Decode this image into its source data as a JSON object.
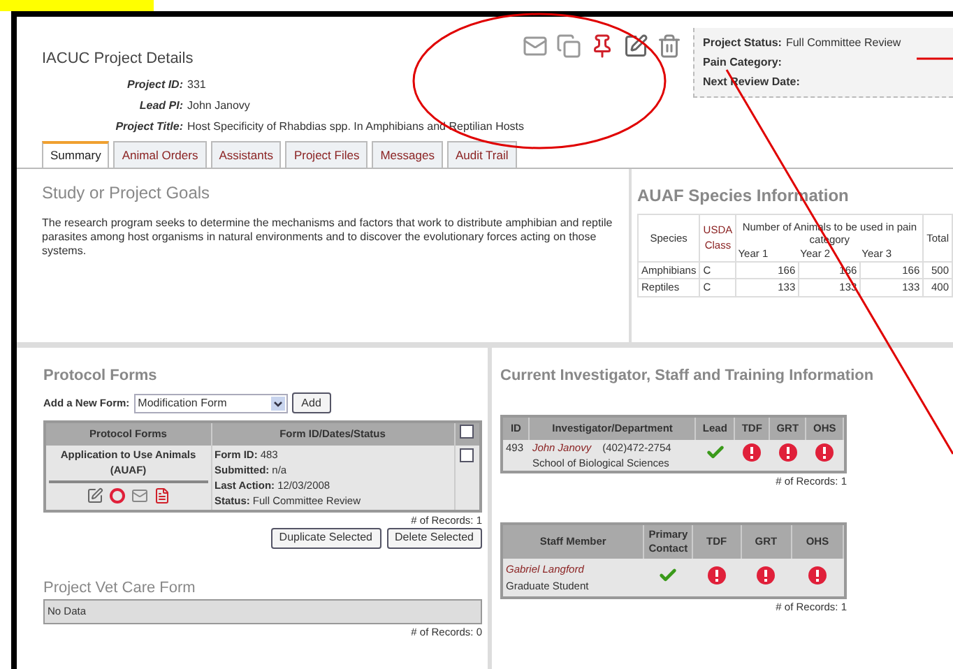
{
  "header": {
    "title": "IACUC Project Details",
    "fields": [
      {
        "label": "Project ID:",
        "value": "331"
      },
      {
        "label": "Lead PI:",
        "value": "John Janovy"
      },
      {
        "label": "Project Title:",
        "value": "Host Specificity of Rhabdias spp. In Amphibians and Reptilian Hosts"
      }
    ]
  },
  "status_panel": [
    {
      "label": "Project Status:",
      "value": "Full Committee Review"
    },
    {
      "label": "Pain Category:"
    },
    {
      "label": "Next Review Date:"
    }
  ],
  "tabs": [
    {
      "label": "Summary",
      "selected": true
    },
    {
      "label": "Animal Orders",
      "selected": false
    },
    {
      "label": "Assistants",
      "selected": false
    },
    {
      "label": "Project Files",
      "selected": false
    },
    {
      "label": "Messages",
      "selected": false
    },
    {
      "label": "Audit Trail",
      "selected": false
    }
  ],
  "goals": {
    "title": "Study or Project Goals",
    "text": "The research program seeks to determine the mechanisms and factors that work to distribute amphibian and reptile parasites among host organisms in natural environments and to discover the evolutionary forces acting on those systems."
  },
  "species": {
    "title": "AUAF Species Information",
    "columns": {
      "species": "Species",
      "usda": "USDA Class",
      "number": "Number of Animals to be used in pain category",
      "total": "Total",
      "years": [
        "Year 1",
        "Year 2",
        "Year 3"
      ]
    },
    "rows": [
      {
        "species": "Amphibians",
        "usda": "C",
        "years": [
          "166",
          "166",
          "166"
        ],
        "total": "500"
      },
      {
        "species": "Reptiles",
        "usda": "C",
        "years": [
          "133",
          "133",
          "133"
        ],
        "total": "400"
      }
    ]
  },
  "protocol_forms": {
    "title": "Protocol Forms",
    "add_label": "Add a New Form:",
    "select_value": "Modification Form",
    "add_button": "Add",
    "columns": [
      "Protocol Forms",
      "Form ID/Dates/Status"
    ],
    "header_checked": false,
    "rows": [
      {
        "name": "Application to Use Animals (AUAF)",
        "checked": false,
        "details": [
          {
            "label": "Form ID:",
            "value": "483"
          },
          {
            "label": "Submitted:",
            "value": "n/a"
          },
          {
            "label": "Last Action:",
            "value": "12/03/2008"
          },
          {
            "label": "Status:",
            "value": "Full Committee Review"
          }
        ]
      }
    ],
    "record_count": "# of Records: 1",
    "buttons": [
      "Duplicate Selected",
      "Delete Selected"
    ]
  },
  "vet_care": {
    "title": "Project Vet Care Form",
    "empty": "No Data",
    "record_count": "# of Records: 0"
  },
  "training": {
    "title": "Current Investigator, Staff and Training Information",
    "investigators": {
      "columns": [
        "ID",
        "Investigator/Department",
        "Lead",
        "TDF",
        "GRT",
        "OHS"
      ],
      "rows": [
        {
          "id": "493",
          "name": "John Janovy",
          "phone": "(402)472-2754",
          "department": "School of Biological Sciences",
          "lead": true,
          "tdf": false,
          "grt": false,
          "ohs": false
        }
      ],
      "record_count": "# of Records: 1"
    },
    "staff": {
      "columns": [
        "Staff Member",
        "Primary Contact",
        "TDF",
        "GRT",
        "OHS"
      ],
      "rows": [
        {
          "name": "Gabriel Langford",
          "role": "Graduate Student",
          "primary": true,
          "tdf": false,
          "grt": false,
          "ohs": false
        }
      ],
      "record_count": "# of Records: 1"
    }
  }
}
